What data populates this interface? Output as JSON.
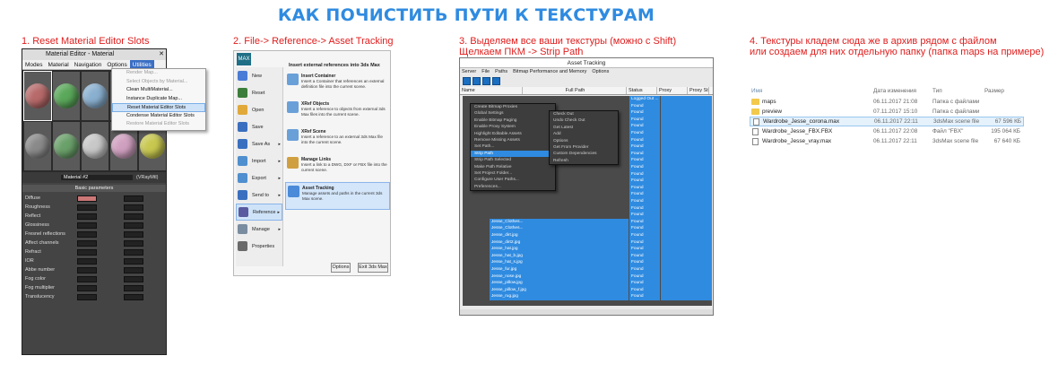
{
  "title": "КАК ПОЧИСТИТЬ ПУТИ К ТЕКСТУРАМ",
  "steps": {
    "s1": "1. Reset Material Editor Slots",
    "s2": "2. File-> Reference-> Asset Tracking",
    "s3a": "3. Выделяем все ваши текстуры (можно с Shift)",
    "s3b": "Щелкаем ПКМ -> Strip Path",
    "s4a": "4. Текстуры кладем сюда же в архив рядом с файлом",
    "s4b": "или создаем для них отдельную папку (папка maps на примере)"
  },
  "colors": {
    "title": "#2f8be0",
    "step": "#e01d1d",
    "selection": "#2f8be0"
  },
  "material_editor": {
    "window_title": "Material Editor - Material",
    "menus": [
      "Modes",
      "Material",
      "Navigation",
      "Options",
      "Utilities"
    ],
    "swatches": [
      "#b86a6a",
      "#5aa85a",
      "#8ab0d0",
      "#7a7a7a",
      "#b07ab0",
      "#8a8a8a",
      "#6aa06a",
      "#c8c8c8",
      "#d0a0c0",
      "#c8c850"
    ],
    "material_name": "Material #2",
    "renderer": "(VRayMtl)",
    "section": "Basic parameters",
    "rows": [
      "Diffuse",
      "Roughness",
      "Reflect",
      "Glossiness",
      "Fresnel reflections",
      "Affect channels",
      "Refract",
      "IOR",
      "Abbe number",
      "Fog color",
      "Fog multiplier",
      "Translucency"
    ],
    "utilities_menu": [
      "Render Map...",
      "Select Objects by Material...",
      "Clean MultiMaterial...",
      "Instance Duplicate Map...",
      "Reset Material Editor Slots",
      "Condense Material Editor Slots",
      "Restore Material Editor Slots"
    ]
  },
  "app_menu": {
    "logo": "MAX",
    "left_items": [
      {
        "label": "New",
        "color": "#4a7bd6"
      },
      {
        "label": "Reset",
        "color": "#3b7d3b"
      },
      {
        "label": "Open",
        "color": "#e0a93a"
      },
      {
        "label": "Save",
        "color": "#3a6fc0"
      },
      {
        "label": "Save As",
        "color": "#3a6fc0"
      },
      {
        "label": "Import",
        "color": "#4f8fcf"
      },
      {
        "label": "Export",
        "color": "#4f8fcf"
      },
      {
        "label": "Send to",
        "color": "#3a6fc0"
      },
      {
        "label": "Reference",
        "color": "#5a5aa0"
      },
      {
        "label": "Manage",
        "color": "#7a8ca0"
      },
      {
        "label": "Properties",
        "color": "#6a6a6a"
      }
    ],
    "heading": "Insert external references into 3ds Max",
    "items": [
      {
        "title": "Insert Container",
        "desc": "Insert a Container that references an external definition file into the current scene.",
        "color": "#6aa0d8"
      },
      {
        "title": "XRef Objects",
        "desc": "Insert a reference to objects from external 3ds Max files into the current scene.",
        "color": "#6aa0d8"
      },
      {
        "title": "XRef Scene",
        "desc": "Insert a reference to an external 3ds Max file into the current scene.",
        "color": "#6aa0d8"
      },
      {
        "title": "Manage Links",
        "desc": "Insert a link to a DWG, DXF or FBX file into the current scene.",
        "color": "#d0a040"
      },
      {
        "title": "Asset Tracking",
        "desc": "Manage assets and paths in the current 3ds Max scene.",
        "color": "#4a8ad8"
      }
    ],
    "options_btn": "Options",
    "exit_btn": "Exit 3ds Max"
  },
  "asset_tracking": {
    "window_title": "Asset Tracking",
    "menus": [
      "Server",
      "File",
      "Paths",
      "Bitmap Performance and Memory",
      "Options"
    ],
    "columns": [
      "Name",
      "Full Path",
      "Status",
      "Proxy Resol...",
      "Proxy St"
    ],
    "found": "Found",
    "status_first": "Logged Out ...",
    "files": [
      "Jesse_Clothes...",
      "Jesse_Clothes...",
      "Jesse_dirt.jpg",
      "Jesse_dirt2.jpg",
      "Jesse_hat.jpg",
      "Jesse_hat_b.jpg",
      "Jesse_hat_s.jpg",
      "Jesse_fur.jpg",
      "Jesse_nose.jpg",
      "Jesse_pillow.jpg",
      "Jesse_pillow_f.jpg",
      "Jesse_rug.jpg"
    ],
    "ctx_left": [
      "Create Bitmap Proxies",
      "Global Settings",
      "Enable Bitmap Paging",
      "Enable Proxy System",
      "Highlight Editable Assets",
      "Remove Missing Assets",
      "Set Path...",
      "Strip Path",
      "Strip Path Selected",
      "Make Path Relative",
      "Set Project Folder...",
      "Configure User Paths...",
      "Preferences..."
    ],
    "ctx_right": [
      "Check Out",
      "Undo Check Out",
      "Get Latest",
      "Add",
      "Options",
      "Get From Provider",
      "Custom Dependencies",
      "Refresh"
    ],
    "ctx_highlight": "Strip Path"
  },
  "file_list": {
    "columns": [
      "Имя",
      "Дата изменения",
      "Тип",
      "Размер"
    ],
    "rows": [
      {
        "name": "maps",
        "date": "06.11.2017 21:08",
        "type": "Папка с файлами",
        "size": "",
        "folder": true
      },
      {
        "name": "preview",
        "date": "07.11.2017 15:10",
        "type": "Папка с файлами",
        "size": "",
        "folder": true
      },
      {
        "name": "Wardrobe_Jesse_corona.max",
        "date": "06.11.2017 22:11",
        "type": "3dsMax scene file",
        "size": "67 596 КБ",
        "folder": false,
        "selected": true
      },
      {
        "name": "Wardrobe_Jesse_FBX.FBX",
        "date": "06.11.2017 22:08",
        "type": "Файл \"FBX\"",
        "size": "195 064 КБ",
        "folder": false
      },
      {
        "name": "Wardrobe_Jesse_vray.max",
        "date": "06.11.2017 22:11",
        "type": "3dsMax scene file",
        "size": "67 640 КБ",
        "folder": false
      }
    ]
  }
}
